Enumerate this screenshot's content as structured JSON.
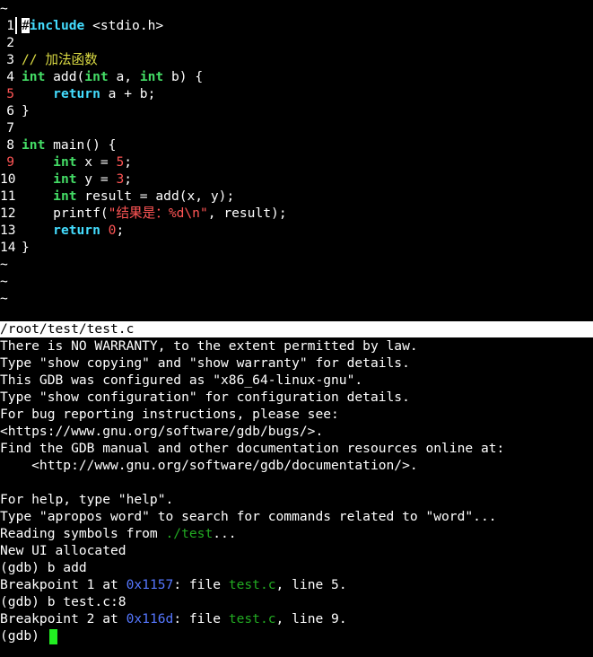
{
  "source": {
    "lines": [
      {
        "type": "tilde",
        "text": "~"
      },
      {
        "type": "code",
        "num": "1",
        "breakpoint": false,
        "tokens": [
          {
            "k": "cursor",
            "t": "#"
          },
          {
            "k": "kw-blue",
            "t": "include"
          },
          {
            "k": "plain",
            "t": " <stdio.h>"
          }
        ]
      },
      {
        "type": "code",
        "num": "2",
        "breakpoint": false,
        "tokens": []
      },
      {
        "type": "code",
        "num": "3",
        "breakpoint": false,
        "tokens": [
          {
            "k": "cmt",
            "t": "// 加法函数"
          }
        ]
      },
      {
        "type": "code",
        "num": "4",
        "breakpoint": false,
        "tokens": [
          {
            "k": "kw",
            "t": "int"
          },
          {
            "k": "plain",
            "t": " add("
          },
          {
            "k": "kw",
            "t": "int"
          },
          {
            "k": "plain",
            "t": " a, "
          },
          {
            "k": "kw",
            "t": "int"
          },
          {
            "k": "plain",
            "t": " b) {"
          }
        ]
      },
      {
        "type": "code",
        "num": "5",
        "breakpoint": true,
        "tokens": [
          {
            "k": "plain",
            "t": "    "
          },
          {
            "k": "kw-blue",
            "t": "return"
          },
          {
            "k": "plain",
            "t": " a + b;"
          }
        ]
      },
      {
        "type": "code",
        "num": "6",
        "breakpoint": false,
        "tokens": [
          {
            "k": "plain",
            "t": "}"
          }
        ]
      },
      {
        "type": "code",
        "num": "7",
        "breakpoint": false,
        "tokens": []
      },
      {
        "type": "code",
        "num": "8",
        "breakpoint": false,
        "tokens": [
          {
            "k": "kw",
            "t": "int"
          },
          {
            "k": "plain",
            "t": " main() {"
          }
        ]
      },
      {
        "type": "code",
        "num": "9",
        "breakpoint": true,
        "tokens": [
          {
            "k": "plain",
            "t": "    "
          },
          {
            "k": "kw",
            "t": "int"
          },
          {
            "k": "plain",
            "t": " x = "
          },
          {
            "k": "num",
            "t": "5"
          },
          {
            "k": "plain",
            "t": ";"
          }
        ]
      },
      {
        "type": "code",
        "num": "10",
        "breakpoint": false,
        "tokens": [
          {
            "k": "plain",
            "t": "    "
          },
          {
            "k": "kw",
            "t": "int"
          },
          {
            "k": "plain",
            "t": " y = "
          },
          {
            "k": "num",
            "t": "3"
          },
          {
            "k": "plain",
            "t": ";"
          }
        ]
      },
      {
        "type": "code",
        "num": "11",
        "breakpoint": false,
        "tokens": [
          {
            "k": "plain",
            "t": "    "
          },
          {
            "k": "kw",
            "t": "int"
          },
          {
            "k": "plain",
            "t": " result = add(x, y);"
          }
        ]
      },
      {
        "type": "code",
        "num": "12",
        "breakpoint": false,
        "tokens": [
          {
            "k": "plain",
            "t": "    printf("
          },
          {
            "k": "str",
            "t": "\"结果是：%d\\n\""
          },
          {
            "k": "plain",
            "t": ", result);"
          }
        ]
      },
      {
        "type": "code",
        "num": "13",
        "breakpoint": false,
        "tokens": [
          {
            "k": "plain",
            "t": "    "
          },
          {
            "k": "kw-blue",
            "t": "return"
          },
          {
            "k": "plain",
            "t": " "
          },
          {
            "k": "num",
            "t": "0"
          },
          {
            "k": "plain",
            "t": ";"
          }
        ]
      },
      {
        "type": "code",
        "num": "14",
        "breakpoint": false,
        "tokens": [
          {
            "k": "plain",
            "t": "}"
          }
        ]
      },
      {
        "type": "tilde",
        "text": "~"
      },
      {
        "type": "tilde",
        "text": "~"
      },
      {
        "type": "tilde",
        "text": "~"
      }
    ]
  },
  "status_bar": {
    "file_path": "/root/test/test.c"
  },
  "gdb": {
    "lines": [
      [
        {
          "k": "plain",
          "t": "There is NO WARRANTY, to the extent permitted by law."
        }
      ],
      [
        {
          "k": "plain",
          "t": "Type \"show copying\" and \"show warranty\" for details."
        }
      ],
      [
        {
          "k": "plain",
          "t": "This GDB was configured as \"x86_64-linux-gnu\"."
        }
      ],
      [
        {
          "k": "plain",
          "t": "Type \"show configuration\" for configuration details."
        }
      ],
      [
        {
          "k": "plain",
          "t": "For bug reporting instructions, please see:"
        }
      ],
      [
        {
          "k": "plain",
          "t": "<https://www.gnu.org/software/gdb/bugs/>."
        }
      ],
      [
        {
          "k": "plain",
          "t": "Find the GDB manual and other documentation resources online at:"
        }
      ],
      [
        {
          "k": "plain",
          "t": "    <http://www.gnu.org/software/gdb/documentation/>."
        }
      ],
      [],
      [
        {
          "k": "plain",
          "t": "For help, type \"help\"."
        }
      ],
      [
        {
          "k": "plain",
          "t": "Type \"apropos word\" to search for commands related to \"word\"..."
        }
      ],
      [
        {
          "k": "plain",
          "t": "Reading symbols from "
        },
        {
          "k": "file",
          "t": "./test"
        },
        {
          "k": "plain",
          "t": "..."
        }
      ],
      [
        {
          "k": "plain",
          "t": "New UI allocated"
        }
      ],
      [
        {
          "k": "plain",
          "t": "(gdb) b add"
        }
      ],
      [
        {
          "k": "plain",
          "t": "Breakpoint 1 at "
        },
        {
          "k": "addr",
          "t": "0x1157"
        },
        {
          "k": "plain",
          "t": ": file "
        },
        {
          "k": "file",
          "t": "test.c"
        },
        {
          "k": "plain",
          "t": ", line 5."
        }
      ],
      [
        {
          "k": "plain",
          "t": "(gdb) b test.c:8"
        }
      ],
      [
        {
          "k": "plain",
          "t": "Breakpoint 2 at "
        },
        {
          "k": "addr",
          "t": "0x116d"
        },
        {
          "k": "plain",
          "t": ": file "
        },
        {
          "k": "file",
          "t": "test.c"
        },
        {
          "k": "plain",
          "t": ", line 9."
        }
      ]
    ],
    "prompt": "(gdb) "
  },
  "colors": {
    "background": "#000000",
    "keyword": "#44dd66",
    "keyword_control": "#44ddff",
    "number_string": "#ff5555",
    "comment": "#dddd44",
    "address": "#5577ff",
    "filename": "#22aa22",
    "cursor": "#22ee22",
    "status_bar_bg": "#ffffff"
  }
}
